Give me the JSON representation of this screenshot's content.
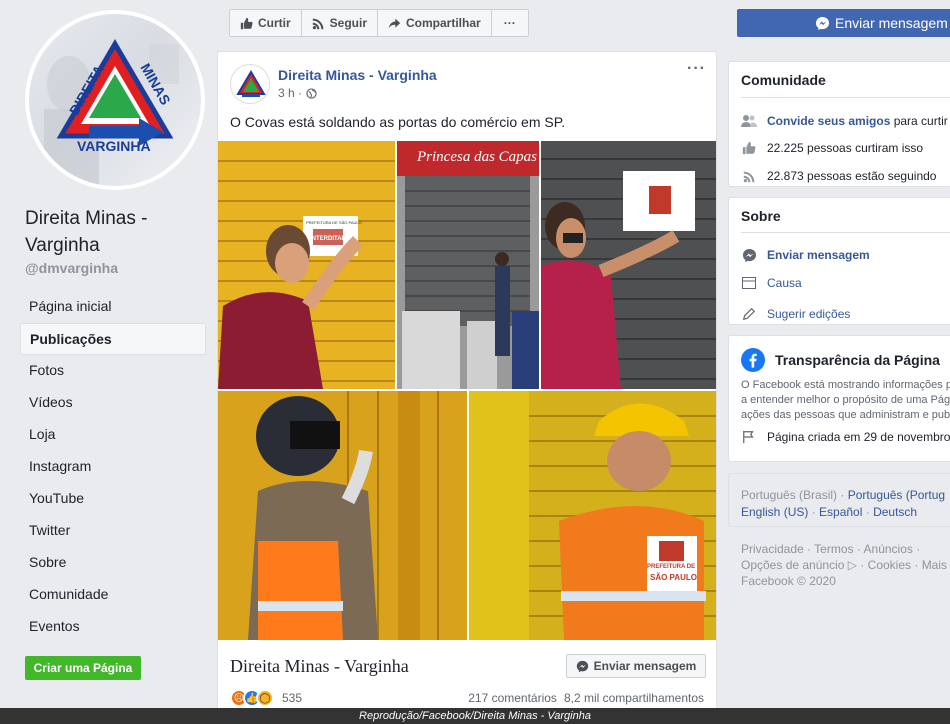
{
  "sidebar": {
    "page_name": "Direita Minas - Varginha",
    "handle": "@dmvarginha",
    "logo_text_top": "DIREITA",
    "logo_text_right": "MINAS",
    "logo_text_bottom": "VARGINHA",
    "nav": [
      {
        "label": "Página inicial",
        "active": false
      },
      {
        "label": "Publicações",
        "active": true
      },
      {
        "label": "Fotos",
        "active": false
      },
      {
        "label": "Vídeos",
        "active": false
      },
      {
        "label": "Loja",
        "active": false
      },
      {
        "label": "Instagram",
        "active": false
      },
      {
        "label": "YouTube",
        "active": false
      },
      {
        "label": "Twitter",
        "active": false
      },
      {
        "label": "Sobre",
        "active": false
      },
      {
        "label": "Comunidade",
        "active": false
      },
      {
        "label": "Eventos",
        "active": false
      }
    ],
    "create_page_label": "Criar uma Página"
  },
  "actionbar": {
    "like_label": "Curtir",
    "follow_label": "Seguir",
    "share_label": "Compartilhar",
    "more_label": "···",
    "send_message_label": "Enviar mensagem"
  },
  "post": {
    "author": "Direita Minas - Varginha",
    "time": "3 h ·",
    "more_label": "···",
    "text": "O Covas está soldando as portas do comércio em SP.",
    "photo_sign_1": "PREFEITURA DE SÃO PAULO",
    "photo_sign_1b": "INTERDITADO",
    "photo_store_sign": "Princesa das Capas",
    "vest_label_line1": "PREFEITURA DE",
    "vest_label_line2": "SÃO PAULO",
    "link_title": "Direita Minas - Varginha",
    "send_message_label": "Enviar mensagem",
    "reaction_count": "535",
    "comments": "217 comentários",
    "shares": "8,2 mil compartilhamentos"
  },
  "community": {
    "title": "Comunidade",
    "invite_link": "Convide seus amigos",
    "invite_rest": " para curtir",
    "likes": "22.225 pessoas curtiram isso",
    "follows": "22.873 pessoas estão seguindo"
  },
  "about": {
    "title": "Sobre",
    "send_message": "Enviar mensagem",
    "cause": "Causa",
    "suggest": "Sugerir edições"
  },
  "transparency": {
    "title": "Transparência da Página",
    "desc_line1": "O Facebook está mostrando informações p",
    "desc_line2": "a entender melhor o propósito de uma Págin",
    "desc_line3": "ações das pessoas que administram e publ",
    "created": "Página criada em 29 de novembro"
  },
  "languages": {
    "current": "Português (Brasil)",
    "options": [
      "Português (Portug",
      "English (US)",
      "Español",
      "Deutsch"
    ]
  },
  "footer": {
    "line1": [
      "Privacidade",
      "Termos",
      "Anúncios"
    ],
    "line2": [
      "Opções de anúncio",
      "Cookies",
      "Mais"
    ],
    "copyright": "Facebook © 2020"
  },
  "caption": "Reprodução/Facebook/Direita Minas - Varginha",
  "colors": {
    "fb_blue": "#4267b2",
    "link_blue": "#365899",
    "green": "#42b72a",
    "background": "#e9ebee"
  }
}
